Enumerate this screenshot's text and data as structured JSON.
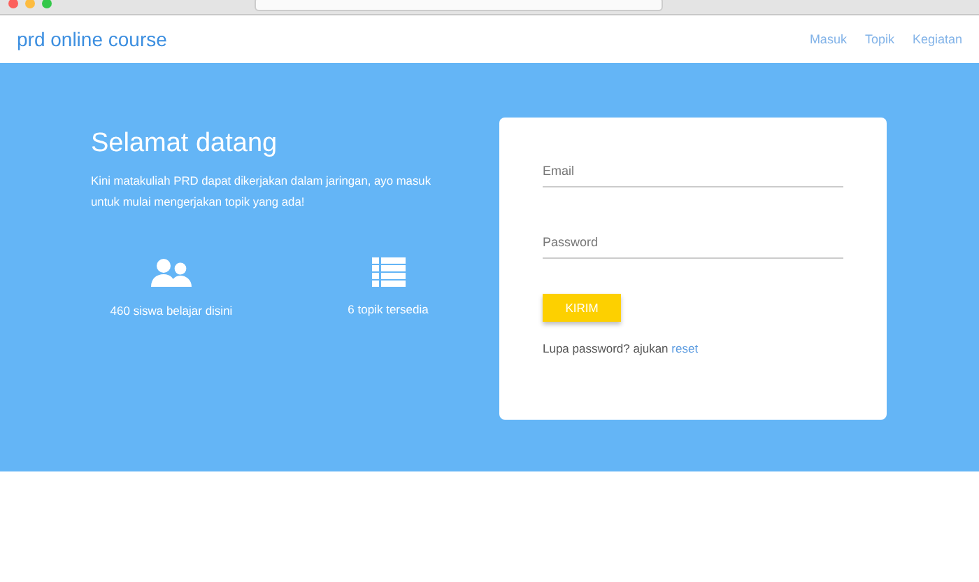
{
  "navbar": {
    "brand": "prd online course",
    "links": [
      "Masuk",
      "Topik",
      "Kegiatan"
    ]
  },
  "hero": {
    "title": "Selamat datang",
    "description": "Kini matakuliah PRD dapat dikerjakan dalam jaringan, ayo masuk untuk mulai mengerjakan topik yang ada!",
    "stats": [
      {
        "kind": "students",
        "label": "460 siswa belajar disini"
      },
      {
        "kind": "topics",
        "label": "6 topik tersedia"
      }
    ]
  },
  "login": {
    "fields": [
      {
        "kind": "email",
        "placeholder": "Email"
      },
      {
        "kind": "password",
        "placeholder": "Password"
      }
    ],
    "submit": "KIRIM",
    "forgot_text": "Lupa password? ajukan",
    "reset_link": "reset"
  }
}
